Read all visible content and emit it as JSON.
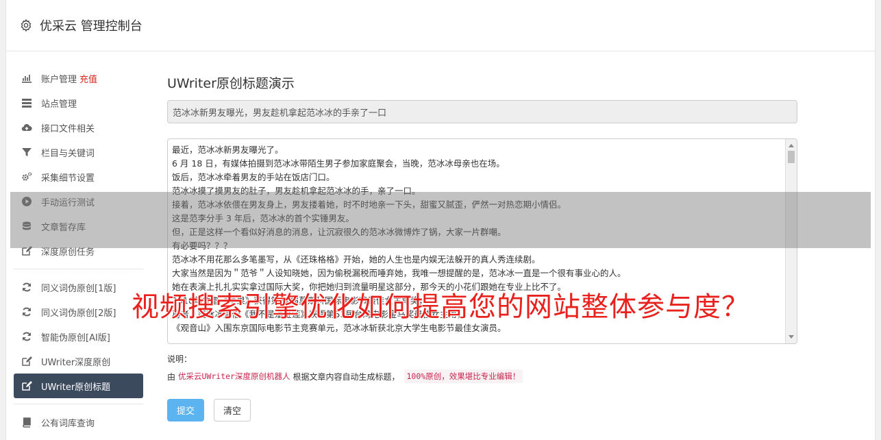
{
  "header": {
    "title": "优采云 管理控制台",
    "icon": "gear-icon"
  },
  "sidebar": {
    "groups": [
      [
        {
          "label": "账户管理",
          "badge": "充值",
          "icon": "bar-chart-icon"
        },
        {
          "label": "站点管理",
          "icon": "server-icon"
        },
        {
          "label": "接口文件相关",
          "icon": "cloud-upload-icon"
        },
        {
          "label": "栏目与关键词",
          "icon": "filter-icon"
        },
        {
          "label": "采集细节设置",
          "icon": "cogs-icon"
        },
        {
          "label": "手动运行测试",
          "icon": "play-circle-icon"
        },
        {
          "label": "文章暂存库",
          "icon": "database-icon"
        },
        {
          "label": "深度原创任务",
          "icon": "edit-icon"
        }
      ],
      [
        {
          "label": "同义词伪原创[1版]",
          "icon": "refresh-icon"
        },
        {
          "label": "同义词伪原创[2版]",
          "icon": "refresh-icon"
        },
        {
          "label": "智能伪原创[AI版]",
          "icon": "refresh-icon"
        },
        {
          "label": "UWriter深度原创",
          "icon": "edit-icon"
        },
        {
          "label": "UWriter原创标题",
          "icon": "edit-icon",
          "active": true
        }
      ],
      [
        {
          "label": "公有词库查询",
          "icon": "book-icon"
        }
      ]
    ]
  },
  "main": {
    "title": "UWriter原创标题演示",
    "title_value": "范冰冰新男友曝光，男友趁机拿起范冰冰的手亲了一口",
    "content_lines": [
      "最近，范冰冰新男友曝光了。",
      "6 月 18 日，有媒体拍摄到范冰冰带陌生男子参加家庭聚会，当晚，范冰冰母亲也在场。",
      "饭后，范冰冰牵着男友的手站在饭店门口。",
      "范冰冰摸了摸男友的肚子，男友趁机拿起范冰冰的手，亲了一口。",
      "接着，范冰冰依偎在男友身上，男友搂着她，时不时地亲一下头，甜蜜又腻歪，俨然一对热恋期小情侣。",
      "这是范李分手 3 年后，范冰冰的首个实锤男友。",
      "但，正是这样一个看似好消息的消息，让沉寂很久的范冰冰微博炸了锅，大家一片群嘲。",
      "有必要吗？？？",
      "范冰冰不用花那么多笔墨写，从《还珠格格》开始，她的人生也是内娱无法躲开的真人秀连续剧。",
      "大家当然是因为＂范爷＂人设知晓她，因为偷税漏税而唾弃她，我唯一想提醒的是，范冰冰一直是一个很有事业心的人。",
      "她在表演上扎扎实实拿过国际大奖，你把她归到流量明星这部分，那今天的小花们跟她在专业上比不了。",
      "2010年凭借《苹果》获得第32届莫斯科国际电影节最佳女主角奖，",
      "再者，范冰冰凭借《我不是潘金莲》获得第53届台湾电影金马奖最佳女主角，",
      "《观音山》入围东京国际电影节主竞赛单元，范冰冰斩获北京大学生电影节最佳女演员。"
    ],
    "note_label": "说明：",
    "note_prefix": "由",
    "note_link": "优采云UWriter深度原创机器人",
    "note_middle": "根据文章内容自动生成标题，",
    "note_code": "100%原创，效果堪比专业编辑！",
    "submit_label": "提交",
    "clear_label": "清空"
  },
  "overlay": {
    "caption": "视频搜索引擎优化如何提高您的网站整体参与度？"
  },
  "colors": {
    "active_bg": "#3c4a5e",
    "submit_bg": "#5bb4f0",
    "caption": "#e8211d",
    "badge": "#d9251d"
  }
}
